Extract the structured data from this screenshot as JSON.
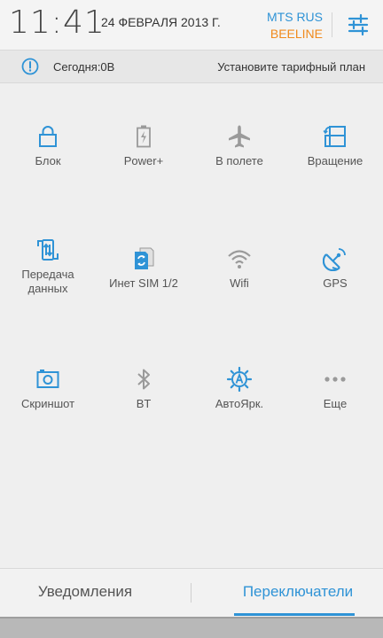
{
  "header": {
    "time": "11:41",
    "date": "24 ФЕВРАЛЯ 2013 Г.",
    "operator1": "MTS RUS",
    "operator2": "BEELINE",
    "settings_icon": "sliders-icon"
  },
  "infobar": {
    "today": "Сегодня:0В",
    "tariff": "Установите тарифный план",
    "icon": "info-icon"
  },
  "toggles": [
    {
      "label": "Блок",
      "icon": "lock-icon",
      "active": true
    },
    {
      "label": "Power+",
      "icon": "battery-icon",
      "active": false
    },
    {
      "label": "В полете",
      "icon": "airplane-icon",
      "active": false
    },
    {
      "label": "Вращение",
      "icon": "rotation-icon",
      "active": true
    },
    {
      "label": "Передача данных",
      "icon": "data-transfer-icon",
      "active": true
    },
    {
      "label": "Инет SIM 1/2",
      "icon": "sim-switch-icon",
      "active": true
    },
    {
      "label": "Wifi",
      "icon": "wifi-icon",
      "active": false
    },
    {
      "label": "GPS",
      "icon": "gps-icon",
      "active": true
    },
    {
      "label": "Скриншот",
      "icon": "camera-icon",
      "active": true
    },
    {
      "label": "BT",
      "icon": "bluetooth-icon",
      "active": false
    },
    {
      "label": "АвтоЯрк.",
      "icon": "auto-brightness-icon",
      "active": true
    },
    {
      "label": "Еще",
      "icon": "more-icon",
      "active": false
    }
  ],
  "tabs": {
    "notifications": "Уведомления",
    "switches": "Переключатели",
    "active": "switches"
  },
  "colors": {
    "accent": "#2f93d6",
    "inactive": "#9a9a9a",
    "operator2": "#f08a1c"
  }
}
